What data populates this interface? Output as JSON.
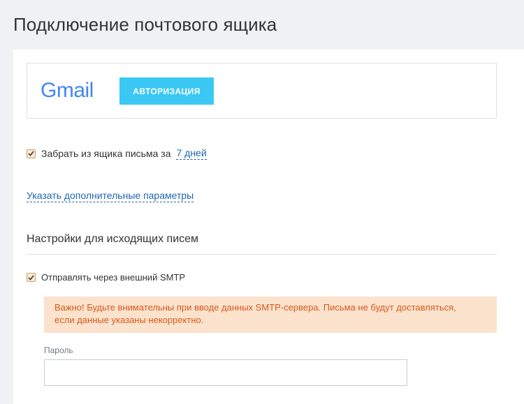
{
  "page": {
    "title": "Подключение почтового ящика"
  },
  "gmail": {
    "logo_text": "Gmail",
    "auth_button_label": "АВТОРИЗАЦИЯ"
  },
  "fetch_mail": {
    "checked": true,
    "label": "Забрать из ящика письма за",
    "period_value": "7 дней"
  },
  "extra_params_link": "Указать дополнительные параметры",
  "outgoing": {
    "section_title": "Настройки для исходящих писем",
    "smtp_checked": true,
    "smtp_label": "Отправлять через внешний SMTP",
    "warning_line1": "Важно! Будьте внимательны при вводе данных SMTP-сервера. Письма не будут доставляться,",
    "warning_line2": "если данные указаны некорректно.",
    "password_label": "Пароль",
    "password_value": ""
  },
  "colors": {
    "accent_button": "#3bc8f5",
    "link": "#2067b0",
    "warning_bg": "#fbe2cc",
    "warning_text": "#d8581c",
    "page_bg": "#eef2f4"
  }
}
